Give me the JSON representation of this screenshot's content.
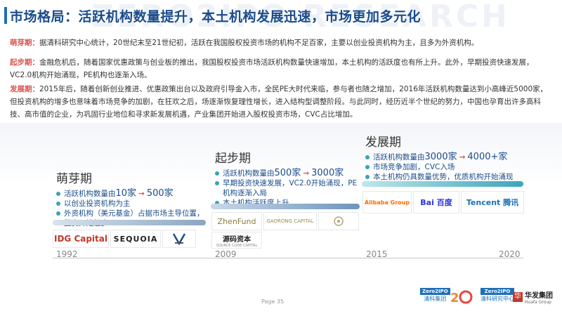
{
  "header": {
    "title": "市场格局：活跃机构数量提升，本土机构发展迅速，市场更加多元化",
    "watermark": "ZERO2IPO RESEARCH"
  },
  "paragraphs": [
    {
      "lead": "萌芽期：",
      "text": "据清科研究中心统计，20世纪末至21世纪初，活跃在我国股权投资市场的机构不足百家，主要以创业投资机构为主，且多为外资机构。"
    },
    {
      "lead": "起步期：",
      "text": "金融危机后，随着国家优惠政策与创业板的推出，我国股权投资市场活跃机构数量快速增加，本土机构的活跃度也有所上升。此外，早期投资快速发展，VC2.0机构开始涌现，PE机构也逐渐入场。"
    },
    {
      "lead": "发展期：",
      "text": "2015年后，随着创新创业推进、优惠政策出台以及政府引导金入市，全民PE大时代来临，参与者也随之增加，2016年活跃机构数量达到小高峰近5000家，但投资机构的增多也意味着市场竞争的加剧，在狂欢之后，场逐渐恢复理性增长，进入结构型调整阶段。与此同时，经历近半个世纪的努力，中国也孕育出许多高科技、高市值的企业，为巩固行业地位和寻求新发展机遇，产业集团开始进入股权投资市场，CVC占比增加。"
    }
  ],
  "stages": [
    {
      "title": "萌芽期",
      "line1_prefix": "活跃机构数量由",
      "line1_from": "10家",
      "line1_arrow": "→",
      "line1_to": "500家",
      "line2": "以创业投资机构为主",
      "line3": "外资机构（美元基金）占据市场主导位置，",
      "line4": "国资开始起步"
    },
    {
      "title": "起步期",
      "line1_prefix": "活跃机构数量由",
      "line1_from": "500家",
      "line1_arrow": "→",
      "line1_to": "3000家",
      "line2": "早期投资快速发展，VC2.0开始涌现，PE",
      "line3": "机构逐渐入局",
      "line4": "本土机构活跃度上升"
    },
    {
      "title": "发展期",
      "line1_prefix": "活跃机构数量由",
      "line1_from": "3000家",
      "line1_arrow": "→",
      "line1_to": "4000+家",
      "line2": "市场竞争加剧，CVC入场",
      "line3": "本土机构仍具数量优势，优质机构开始涌现"
    }
  ],
  "logos": {
    "idg": "IDG Capital",
    "sequoia": "SEQUOIA",
    "zhenfund": "ZhenFund",
    "gaorong": "GAORONG CAPITAL",
    "yuanma": "源码资本",
    "yuanma_sub": "SOURCE CODE CAPITAL",
    "alibaba": "Alibaba Group",
    "baidu": "Bai 百度",
    "tencent": "Tencent 腾讯"
  },
  "timeline": {
    "years": [
      "1992",
      "2009",
      "2015",
      "2020"
    ]
  },
  "footer": {
    "page_label": "Page",
    "page_number": "35",
    "brand1": "清科集团",
    "brand2": "清科研究中心",
    "brand3": "华发集团",
    "brand3_en": "Huafa Group"
  },
  "colors": {
    "accent": "#1d6fb8",
    "title": "#1a4c8b",
    "highlight": "#d9534f",
    "bullet": "#3aa3b5"
  }
}
